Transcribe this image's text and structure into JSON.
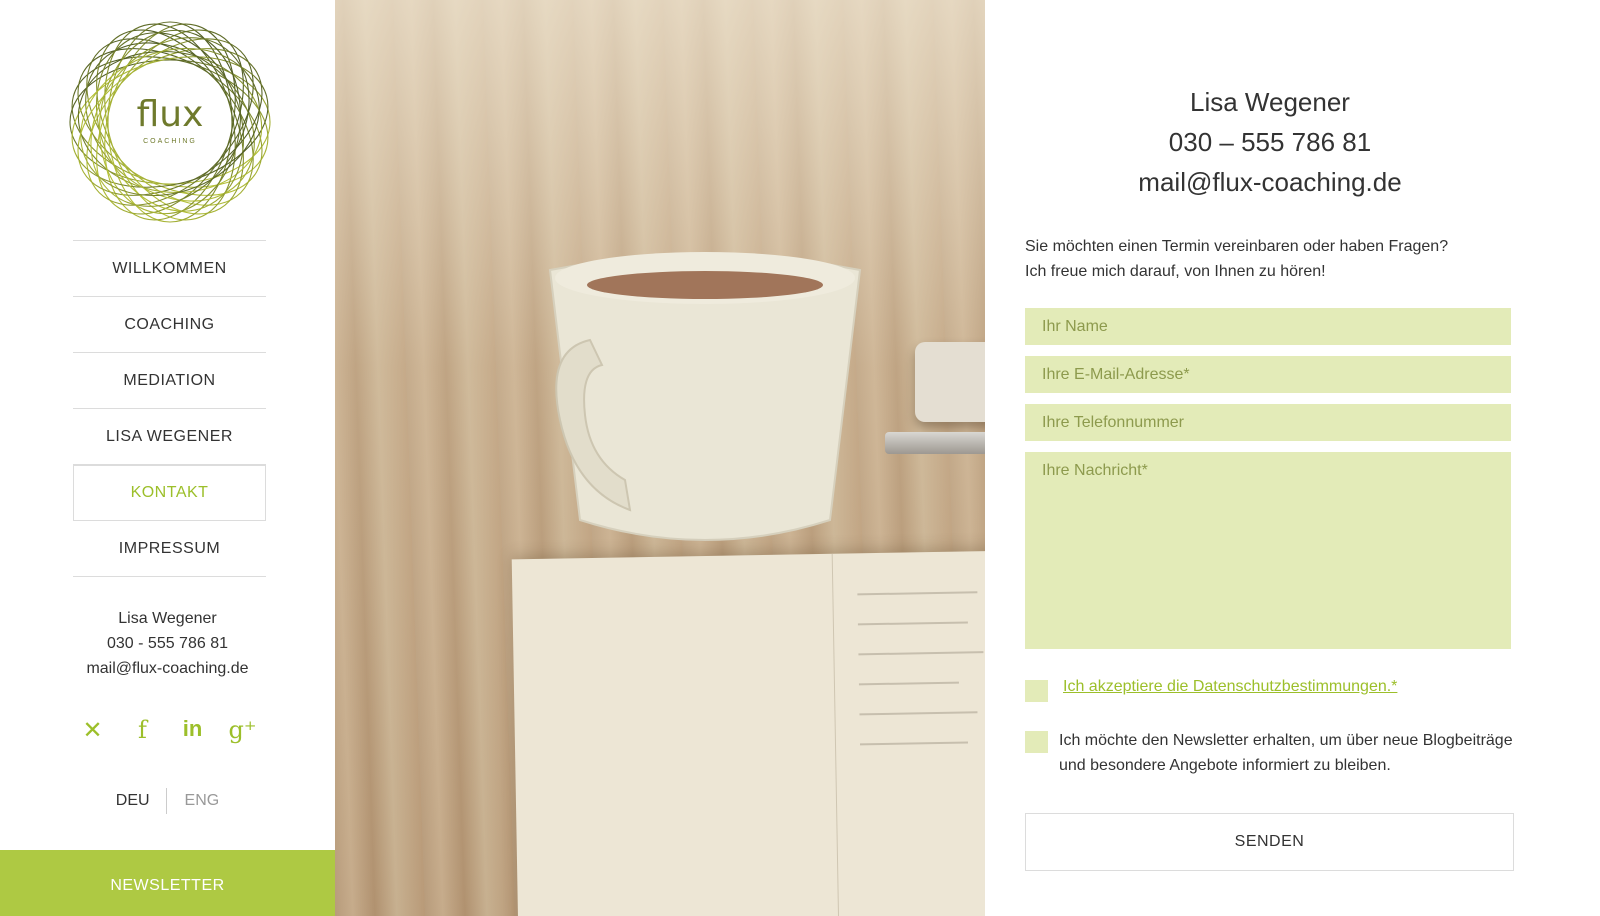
{
  "logo": {
    "text": "flux",
    "sub": "COACHING"
  },
  "nav": [
    {
      "label": "WILLKOMMEN"
    },
    {
      "label": "COACHING"
    },
    {
      "label": "MEDIATION"
    },
    {
      "label": "LISA WEGENER"
    },
    {
      "label": "KONTAKT",
      "active": true
    },
    {
      "label": "IMPRESSUM"
    }
  ],
  "sidebar_contact": {
    "name": "Lisa Wegener",
    "phone": "030 - 555 786 81",
    "email": "mail@flux-coaching.de"
  },
  "social_icons": [
    "xing-icon",
    "facebook-icon",
    "linkedin-icon",
    "google-plus-icon"
  ],
  "language": {
    "deu": "DEU",
    "eng": "ENG",
    "active": "DEU"
  },
  "newsletter_button": "NEWSLETTER",
  "contact": {
    "name": "Lisa Wegener",
    "phone": "030 – 555 786 81",
    "email": "mail@flux-coaching.de",
    "intro_line1": "Sie möchten einen Termin vereinbaren oder haben Fragen?",
    "intro_line2": "Ich freue mich darauf, von Ihnen zu hören!"
  },
  "form": {
    "name_placeholder": "Ihr Name",
    "email_placeholder": "Ihre E-Mail-Adresse*",
    "phone_placeholder": "Ihre Telefonnummer",
    "message_placeholder": "Ihre Nachricht*",
    "privacy_label": "Ich akzeptiere die Datenschutzbestimmungen.*",
    "newsletter_label": "Ich möchte den Newsletter erhalten, um über neue Blogbeiträge und besondere Angebote informiert zu bleiben.",
    "submit_label": "SENDEN"
  },
  "colors": {
    "accent": "#9cbf2a",
    "newsletter_bg": "#aec943",
    "field_bg": "#e3ebb8"
  }
}
